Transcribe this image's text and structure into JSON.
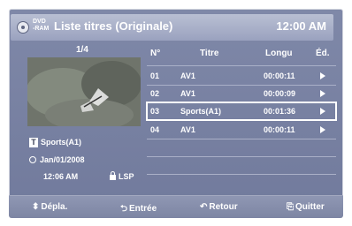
{
  "header": {
    "disc_label": "DVD\n-RAM",
    "title": "Liste titres (Originale)",
    "clock": "12:00 AM"
  },
  "preview": {
    "counter": "1/4",
    "title": "Sports(A1)",
    "date": "Jan/01/2008",
    "time": "12:06 AM",
    "mode": "LSP"
  },
  "columns": {
    "no": "N°",
    "title": "Titre",
    "length": "Longu",
    "edit": "Éd."
  },
  "rows": [
    {
      "no": "01",
      "title": "AV1",
      "length": "00:00:11"
    },
    {
      "no": "02",
      "title": "AV1",
      "length": "00:00:09"
    },
    {
      "no": "03",
      "title": "Sports(A1)",
      "length": "00:01:36"
    },
    {
      "no": "04",
      "title": "AV1",
      "length": "00:00:11"
    }
  ],
  "footer": {
    "move": "Dépla.",
    "enter": "Entrée",
    "back": "Retour",
    "quit": "Quitter"
  },
  "icons": {
    "disc": "disc-icon",
    "title_tag": "t-box-icon",
    "clock": "clock-icon",
    "lock": "unlock-icon",
    "play": "play-icon",
    "move": "up-down-arrows-icon",
    "enter": "enter-icon",
    "back": "return-arrow-icon",
    "quit": "exit-door-icon"
  }
}
